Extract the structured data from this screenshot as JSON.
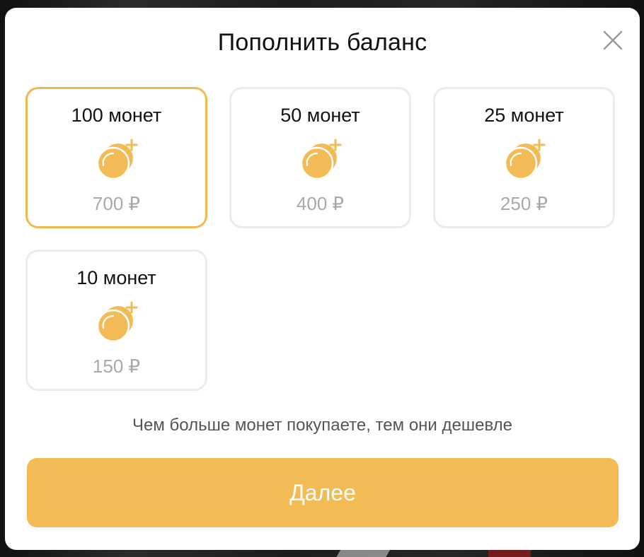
{
  "modal": {
    "title": "Пополнить баланс",
    "close_icon": "close-icon",
    "packages": [
      {
        "coins_label": "100 монет",
        "price": "700 ₽",
        "selected": true,
        "icon": "coins-plus-icon"
      },
      {
        "coins_label": "50 монет",
        "price": "400 ₽",
        "selected": false,
        "icon": "coins-plus-icon"
      },
      {
        "coins_label": "25 монет",
        "price": "250 ₽",
        "selected": false,
        "icon": "coins-plus-icon"
      },
      {
        "coins_label": "10 монет",
        "price": "150 ₽",
        "selected": false,
        "icon": "coins-plus-icon"
      }
    ],
    "hint": "Чем больше монет покупаете, тем они дешевле",
    "next_label": "Далее"
  },
  "colors": {
    "accent": "#f3bb55",
    "selected_border": "#f2b94f",
    "card_border": "#ececec",
    "price_text": "#a9a9a9"
  }
}
